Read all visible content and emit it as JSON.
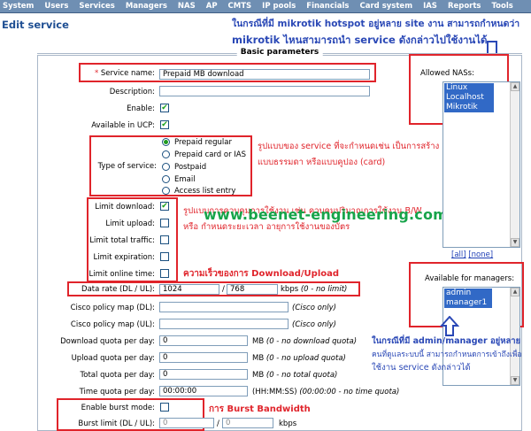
{
  "nav": [
    "System",
    "Users",
    "Services",
    "Managers",
    "NAS",
    "AP",
    "CMTS",
    "IP pools",
    "Financials",
    "Card system",
    "IAS",
    "Reports",
    "Tools"
  ],
  "page_title": "Edit service",
  "panel_title": "Basic parameters",
  "form": {
    "service_name_req": "*",
    "service_name_label": " Service name:",
    "service_name_value": "Prepaid MB download",
    "description_label": "Description:",
    "description_value": "",
    "enable_label": "Enable:",
    "enable_checked": true,
    "available_ucp_label": "Available in UCP:",
    "available_ucp_checked": true,
    "type_label": "Type of service:",
    "type_options": [
      "Prepaid regular",
      "Prepaid card or IAS",
      "Postpaid",
      "Email",
      "Access list entry"
    ],
    "type_selected": "Prepaid regular",
    "limit_download_label": "Limit download:",
    "limit_download_checked": true,
    "limit_upload_label": "Limit upload:",
    "limit_total_label": "Limit total traffic:",
    "limit_expiration_label": "Limit expiration:",
    "limit_online_label": "Limit online time:",
    "data_rate_label": "Data rate (DL / UL):",
    "data_rate_dl": "1024",
    "data_rate_ul": "768",
    "data_rate_hint": "kbps ",
    "data_rate_hint_italic": "(0 - no limit)",
    "cisco_dl_label": "Cisco policy map (DL):",
    "cisco_ul_label": "Cisco policy map (UL):",
    "cisco_hint": "(Cisco only)",
    "dl_quota_label": "Download quota per day:",
    "dl_quota_value": "0",
    "dl_quota_hint": "MB ",
    "dl_quota_hint_italic": "(0 - no download quota)",
    "ul_quota_label": "Upload quota per day:",
    "ul_quota_value": "0",
    "ul_quota_hint": "MB ",
    "ul_quota_hint_italic": "(0 - no upload quota)",
    "total_quota_label": "Total quota per day:",
    "total_quota_value": "0",
    "total_quota_hint": "MB ",
    "total_quota_hint_italic": "(0 - no total quota)",
    "time_quota_label": "Time quota per day:",
    "time_quota_value": "00:00:00",
    "time_quota_hint": "(HH:MM:SS) ",
    "time_quota_hint_italic": "(00:00:00 - no time quota)",
    "burst_mode_label": "Enable burst mode:",
    "burst_limit_label": "Burst limit (DL / UL):",
    "burst_dl": "0",
    "burst_ul": "0",
    "burst_unit": "kbps"
  },
  "nas": {
    "label": "Allowed NASs:",
    "items": [
      "Linux",
      "Localhost",
      "Mikrotik"
    ],
    "all_link": "[all]",
    "none_link": "[none]"
  },
  "managers": {
    "label": "Available for managers:",
    "items": [
      "admin",
      "manager1"
    ]
  },
  "annotations": {
    "top_line1": "ในกรณีที่มี mikrotik hotspot อยู่หลาย site งาน สามารถกำหนดว่า",
    "top_line2": "mikrotik ไหนสามารถนำ service ดังกล่าวไปใช้งานได้",
    "type_line1": "รูปแบบของ service ที่จะกำหนดเช่น เป็นการสร้าง user",
    "type_line2": "แบบธรรมดา หรือแบบคูปอง (card)",
    "limit_line1": "รูปแบบการควบคุมการใช้งาน เช่น ควบคุมปริมาณการใช้งาน B/W",
    "limit_line2": "หรือ กำหนดระยะเวลา อายุการใช้งานของบัตร",
    "speed": "ความเร็วของการ Download/Upload",
    "managers_line1": "ในกรณีที่มี admin/manager อยู่หลาย",
    "managers_line2": "คนที่ดูแลระบบนี้ สามารถกำหนดการเข้าถึงเพื่อ",
    "managers_line3": "ใช้งาน service ดังกล่าวได้",
    "burst": "การ Burst Bandwidth",
    "watermark": "www.beenet-engineering.com"
  },
  "colors": {
    "nav_bg": "#6f8fb3",
    "annotation_red": "#e0242b",
    "annotation_blue": "#2a48b6",
    "watermark_green": "#17a44a",
    "list_selected": "#3169c6"
  }
}
